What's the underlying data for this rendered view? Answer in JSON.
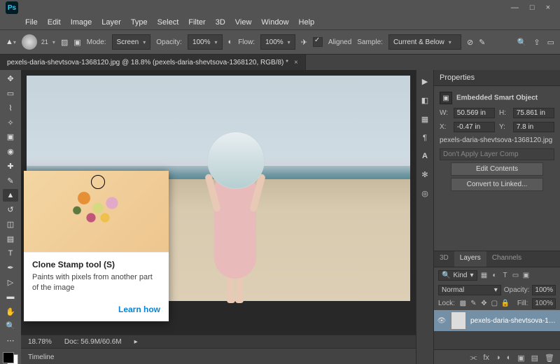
{
  "window": {
    "minimize": "—",
    "maximize": "□",
    "close": "×"
  },
  "menu": [
    "File",
    "Edit",
    "Image",
    "Layer",
    "Type",
    "Select",
    "Filter",
    "3D",
    "View",
    "Window",
    "Help"
  ],
  "options": {
    "brush_size": "21",
    "mode_label": "Mode:",
    "mode_value": "Screen",
    "opacity_label": "Opacity:",
    "opacity_value": "100%",
    "flow_label": "Flow:",
    "flow_value": "100%",
    "aligned_label": "Aligned",
    "sample_label": "Sample:",
    "sample_value": "Current & Below"
  },
  "document": {
    "tab_title": "pexels-daria-shevtsova-1368120.jpg @ 18.8% (pexels-daria-shevtsova-1368120, RGB/8) *"
  },
  "tooltip": {
    "title": "Clone Stamp tool (S)",
    "desc": "Paints with pixels from another part of the image",
    "link": "Learn how"
  },
  "status": {
    "zoom": "18.78%",
    "doc": "Doc: 56.9M/60.6M"
  },
  "timeline": {
    "label": "Timeline"
  },
  "properties": {
    "panel": "Properties",
    "type": "Embedded Smart Object",
    "W_label": "W:",
    "W": "50.569 in",
    "H_label": "H:",
    "H": "75.861 in",
    "X_label": "X:",
    "X": "-0.47 in",
    "Y_label": "Y:",
    "Y": "7.8 in",
    "filename": "pexels-daria-shevtsova-1368120.jpg",
    "layercomp": "Don't Apply Layer Comp",
    "edit_btn": "Edit Contents",
    "convert_btn": "Convert to Linked..."
  },
  "layers": {
    "tabs": [
      "3D",
      "Layers",
      "Channels"
    ],
    "kind_label": "Kind",
    "blend": "Normal",
    "opacity_label": "Opacity:",
    "opacity": "100%",
    "lock_label": "Lock:",
    "fill_label": "Fill:",
    "fill": "100%",
    "items": [
      {
        "name": "pexels-daria-shevtsova-1368..."
      }
    ]
  }
}
